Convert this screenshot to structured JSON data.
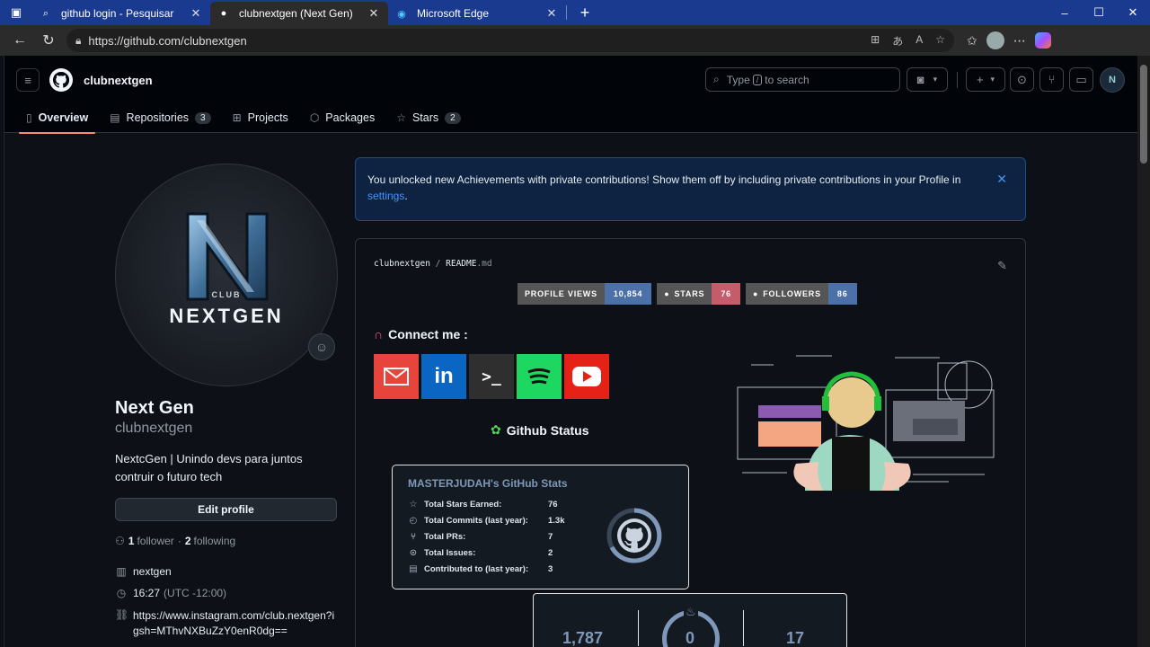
{
  "browser": {
    "tabs": [
      {
        "title": "github login - Pesquisar",
        "icon": "search-icon"
      },
      {
        "title": "clubnextgen (Next Gen)",
        "icon": "github-icon"
      },
      {
        "title": "Microsoft Edge",
        "icon": "edge-icon"
      }
    ],
    "url": "https://github.com/clubnextgen"
  },
  "header": {
    "username": "clubnextgen",
    "search": {
      "before": "Type",
      "key": "/",
      "after": "to search"
    },
    "avatar_text": "N"
  },
  "nav": {
    "tabs": [
      {
        "label": "Overview",
        "count": ""
      },
      {
        "label": "Repositories",
        "count": "3"
      },
      {
        "label": "Projects",
        "count": ""
      },
      {
        "label": "Packages",
        "count": ""
      },
      {
        "label": "Stars",
        "count": "2"
      }
    ]
  },
  "profile": {
    "logo_small": "CLUB",
    "logo_big": "NEXTGEN",
    "name": "Next Gen",
    "login": "clubnextgen",
    "bio": "NextcGen | Unindo devs para juntos contruir o futuro tech",
    "edit_label": "Edit profile",
    "followers": "1",
    "followers_label": "follower",
    "separator": "·",
    "following": "2",
    "following_label": "following",
    "org": "nextgen",
    "time": "16:27",
    "timezone": "(UTC -12:00)",
    "link": "https://www.instagram.com/club.nextgen?igsh=MThvNXBuZzY0enR0dg=="
  },
  "flash": {
    "message": "You unlocked new Achievements with private contributions! Show them off by including private contributions in your Profile in",
    "link": "settings",
    "suffix": "."
  },
  "readme": {
    "owner": "clubnextgen",
    "sep": "/",
    "file": "README",
    "ext": ".md",
    "badges": [
      {
        "label": "PROFILE VIEWS",
        "value": "10,854",
        "color": "#4c71a8"
      },
      {
        "label": "STARS",
        "value": "76",
        "color": "#c55c6b"
      },
      {
        "label": "FOLLOWERS",
        "value": "86",
        "color": "#4c71a8"
      }
    ],
    "connect_title": "Connect me :",
    "socials": [
      "gmail",
      "linkedin",
      "terminal",
      "spotify",
      "youtube"
    ],
    "linkedin_text": "in",
    "terminal_text": ">_",
    "status_title": "Github Status",
    "stats": {
      "title": "MASTERJUDAH's GitHub Stats",
      "rows": [
        {
          "label": "Total Stars Earned:",
          "value": "76",
          "icon": "star-icon"
        },
        {
          "label": "Total Commits (last year):",
          "value": "1.3k",
          "icon": "history-icon"
        },
        {
          "label": "Total PRs:",
          "value": "7",
          "icon": "pull-request-icon"
        },
        {
          "label": "Total Issues:",
          "value": "2",
          "icon": "issue-icon"
        },
        {
          "label": "Contributed to (last year):",
          "value": "3",
          "icon": "repo-icon"
        }
      ]
    },
    "streak": {
      "total": "1,787",
      "current": "0",
      "longest": "17"
    }
  }
}
